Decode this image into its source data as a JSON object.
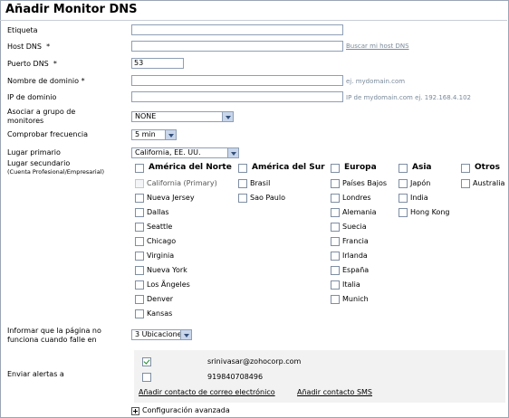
{
  "title": "Añadir Monitor DNS",
  "fields": {
    "etiqueta": {
      "label": "Etiqueta",
      "value": ""
    },
    "host_dns": {
      "label": "Host DNS  *",
      "value": "",
      "link": "Buscar mi host DNS"
    },
    "puerto_dns": {
      "label": "Puerto DNS  *",
      "value": "53"
    },
    "nombre_dominio": {
      "label": "Nombre de dominio *",
      "value": "",
      "hint": "ej. mydomain.com"
    },
    "ip_dominio": {
      "label": "IP de dominio",
      "value": "",
      "hint": "IP de mydomain.com ej. 192.168.4.102"
    },
    "grupo": {
      "label_line1": "Asociar a grupo de",
      "label_line2": "monitores",
      "selected": "NONE"
    },
    "frecuencia": {
      "label": "Comprobar frecuencia",
      "selected": "5 min"
    },
    "lugar_primario": {
      "label": "Lugar primario",
      "selected": "California, EE. UU."
    },
    "lugar_secundario": {
      "label": "Lugar secundario",
      "sublabel": "(Cuenta Profesional/Empresarial)"
    }
  },
  "regions": {
    "america_norte": {
      "header": "América del Norte",
      "items": [
        "California (Primary)",
        "Nueva Jersey",
        "Dallas",
        "Seattle",
        "Chicago",
        "Virginia",
        "Nueva York",
        "Los Ãngeles",
        "Denver",
        "Kansas"
      ]
    },
    "america_sur": {
      "header": "América del Sur",
      "items": [
        "Brasil",
        "Sao Paulo"
      ]
    },
    "europa": {
      "header": "Europa",
      "items": [
        "Países Bajos",
        "Londres",
        "Alemania",
        "Suecia",
        "Francia",
        "Irlanda",
        "España",
        "Italia",
        "Munich"
      ]
    },
    "asia": {
      "header": "Asia",
      "items": [
        "Japón",
        "India",
        "Hong Kong"
      ]
    },
    "otros": {
      "header": "Otros",
      "items": [
        "Australia"
      ]
    }
  },
  "informar": {
    "label_line1": "Informar que la página no",
    "label_line2": "funciona cuando falle en",
    "selected": "3 Ubicaciones"
  },
  "alertas": {
    "label": "Enviar alertas a",
    "contacts": [
      {
        "value": "srinivasar@zohocorp.com",
        "checked": true
      },
      {
        "value": "919840708496",
        "checked": false
      }
    ],
    "add_email": "Añadir contacto de correo electrónico",
    "add_sms": "Añadir contacto SMS"
  },
  "advanced": "Configuración avanzada"
}
